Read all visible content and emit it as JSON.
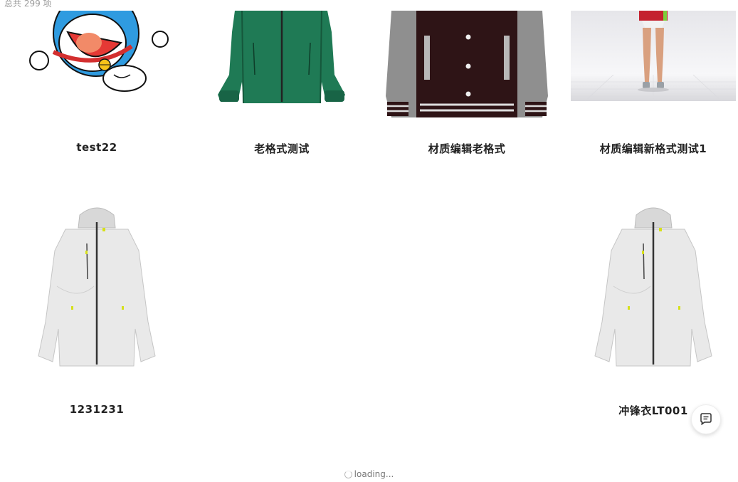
{
  "header": {
    "total_label": "总共 299 项"
  },
  "items": [
    {
      "title": "test22",
      "thumbnail": "doraemon-image"
    },
    {
      "title": "老格式测试",
      "thumbnail": "green-jacket-image"
    },
    {
      "title": "材质编辑老格式",
      "thumbnail": "varsity-jacket-image"
    },
    {
      "title": "材质编辑新格式测试1",
      "thumbnail": "avatar-model-image"
    },
    {
      "title": "1231231",
      "thumbnail": "white-jacket-image"
    },
    {
      "title": "冲锋衣LT001",
      "thumbnail": "white-jacket-image"
    }
  ],
  "footer": {
    "loading_label": "loading..."
  },
  "chat": {
    "icon": "chat-bubble-icon"
  },
  "colors": {
    "background": "#ffffff",
    "title_text": "#222222",
    "muted_text": "#999999",
    "green_jacket": "#1f7a55",
    "varsity_body": "#2e1416"
  }
}
